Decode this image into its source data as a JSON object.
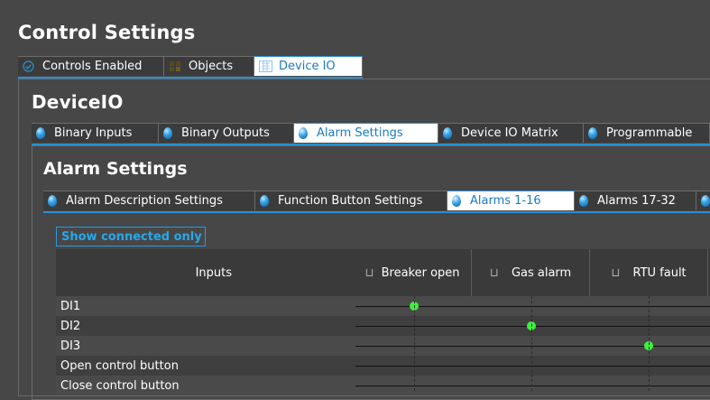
{
  "page": {
    "title": "Control Settings"
  },
  "top_tabs": [
    {
      "label": "Controls Enabled",
      "icon": "check-icon",
      "active": false
    },
    {
      "label": "Objects",
      "icon": "objects-icon",
      "active": false
    },
    {
      "label": "Device IO",
      "icon": "device-io-icon",
      "active": true
    }
  ],
  "device_io": {
    "title": "DeviceIO"
  },
  "deviceio_tabs": [
    {
      "label": "Binary Inputs",
      "active": false
    },
    {
      "label": "Binary Outputs",
      "active": false
    },
    {
      "label": "Alarm Settings",
      "active": true
    },
    {
      "label": "Device IO Matrix",
      "active": false
    },
    {
      "label": "Programmable",
      "active": false
    }
  ],
  "alarm_settings": {
    "title": "Alarm Settings"
  },
  "alarm_tabs": [
    {
      "label": "Alarm Description Settings",
      "active": false
    },
    {
      "label": "Function Button Settings",
      "active": false
    },
    {
      "label": "Alarms 1-16",
      "active": true
    },
    {
      "label": "Alarms 17-32",
      "active": false
    }
  ],
  "show_connected_label": "Show connected only",
  "matrix": {
    "inputs_header": "Inputs",
    "columns": [
      "Breaker open",
      "Gas alarm",
      "RTU fault"
    ],
    "rows": [
      {
        "label": "DI1",
        "connected_column": 0
      },
      {
        "label": "DI2",
        "connected_column": 1
      },
      {
        "label": "DI3",
        "connected_column": 2
      },
      {
        "label": "Open control button",
        "connected_column": null
      },
      {
        "label": "Close control button",
        "connected_column": null
      }
    ]
  },
  "colors": {
    "accent": "#2a8fd0",
    "connected_dot": "#3df03d",
    "background": "#474747"
  }
}
